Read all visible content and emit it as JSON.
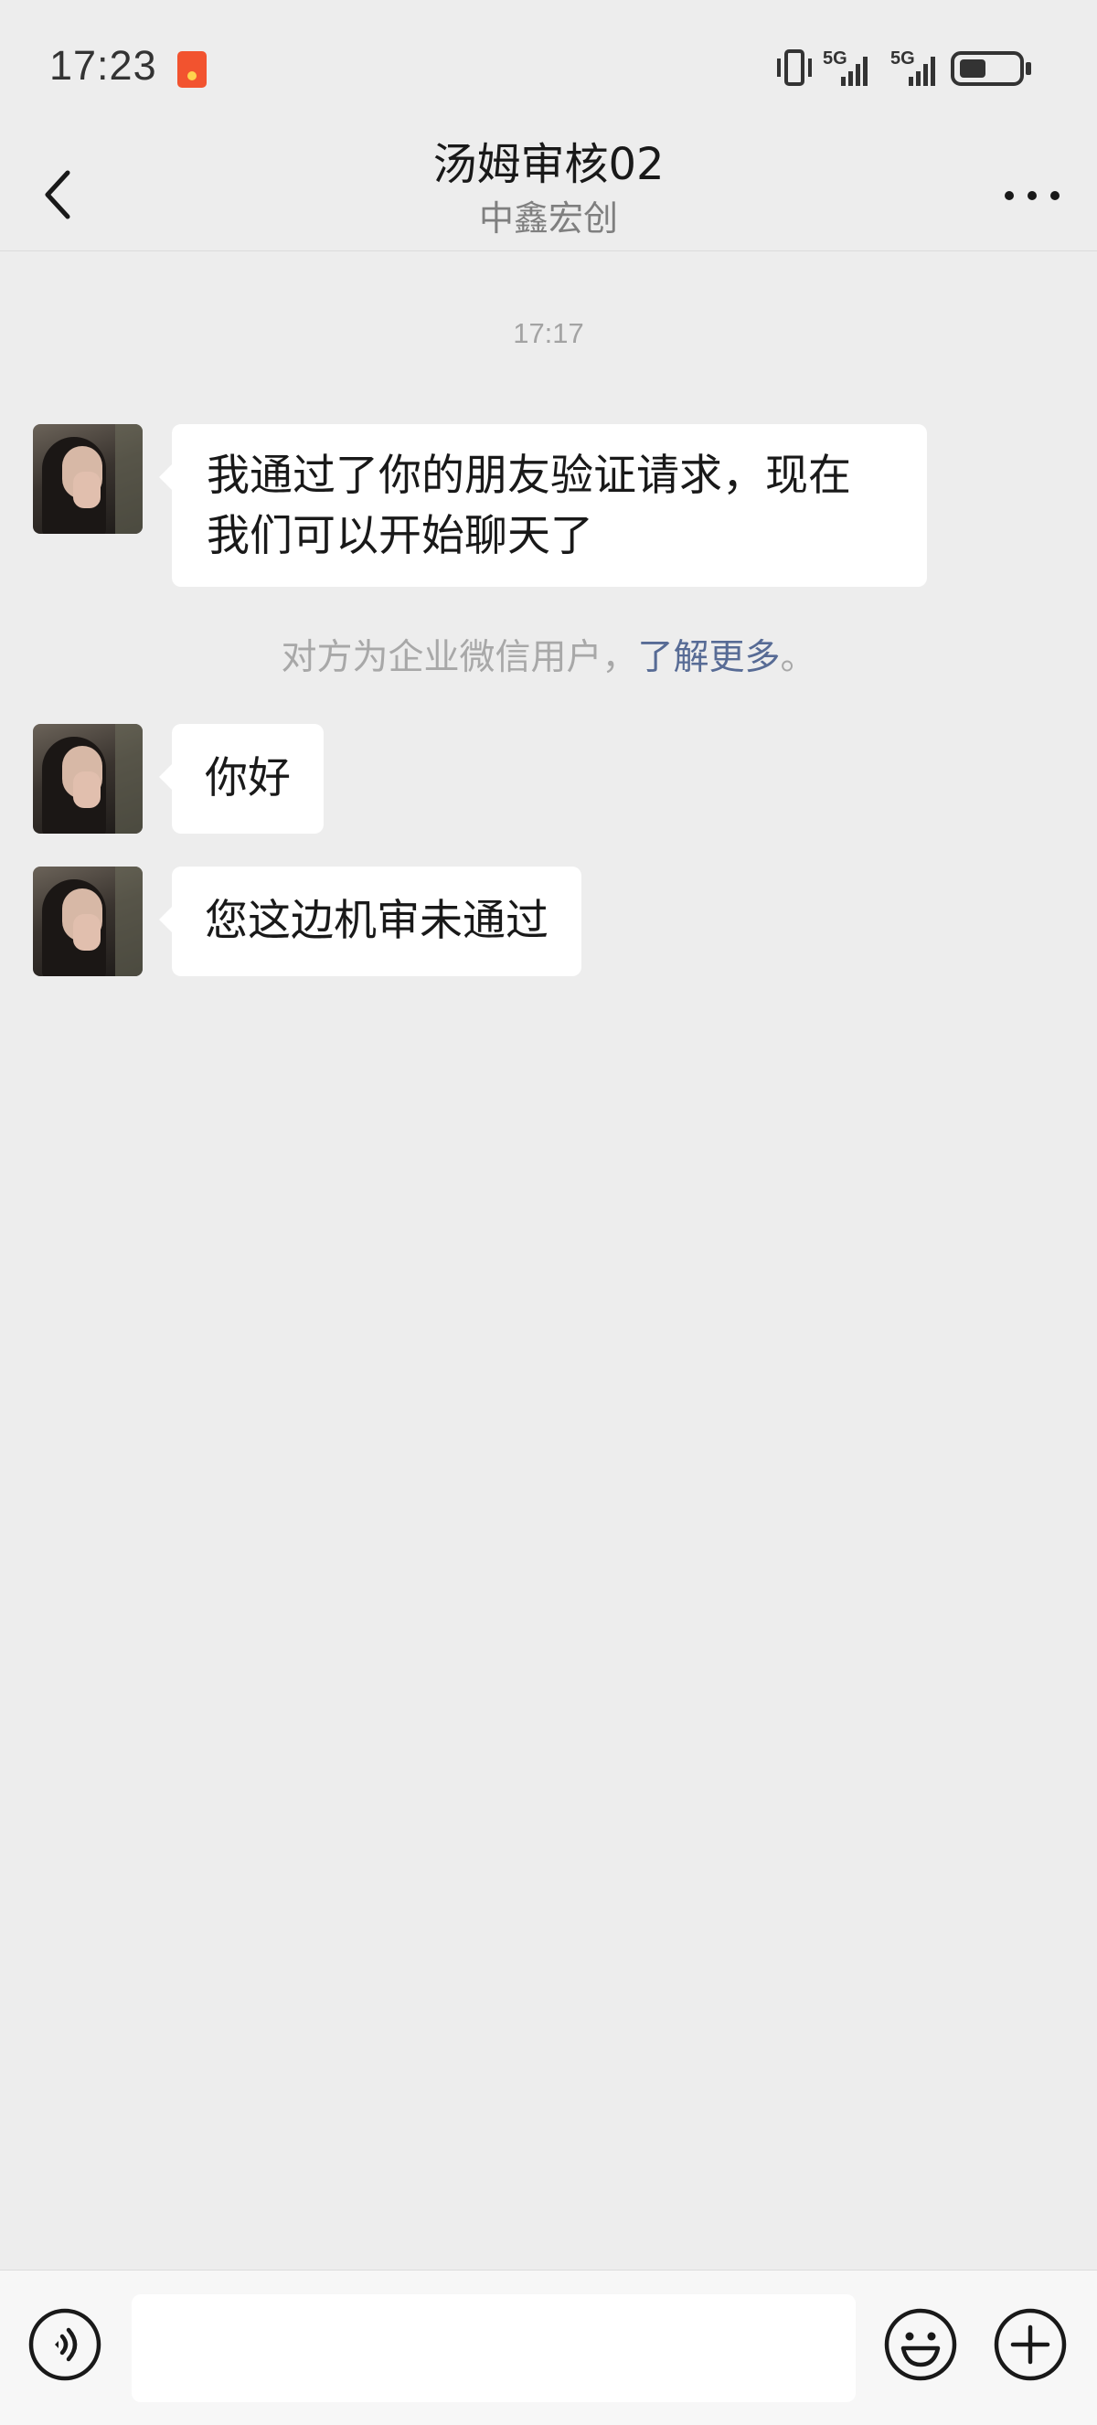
{
  "status_bar": {
    "time": "17:23",
    "signal_1_label": "5G",
    "signal_2_label": "5G"
  },
  "header": {
    "title": "汤姆审核02",
    "subtitle": "中鑫宏创"
  },
  "chat": {
    "timestamp": "17:17",
    "messages": [
      {
        "sender": "other",
        "text_line1": "我通过了你的朋友验证请求，现在",
        "text_line2": "我们可以开始聊天了"
      },
      {
        "sender": "other",
        "text": "你好"
      },
      {
        "sender": "other",
        "text": "您这边机审未通过"
      }
    ],
    "system_note": {
      "text": "对方为企业微信用户，",
      "link": "了解更多",
      "suffix": "。"
    }
  },
  "input_bar": {
    "placeholder": ""
  },
  "colors": {
    "background": "#ededed",
    "bubble": "#ffffff",
    "link": "#576b95",
    "status_app_icon": "#f2532f"
  },
  "icons": [
    "back-arrow-icon",
    "more-icon",
    "voice-icon",
    "emoji-icon",
    "plus-icon",
    "vibrate-icon",
    "signal-icon",
    "battery-icon",
    "notification-app-icon"
  ]
}
